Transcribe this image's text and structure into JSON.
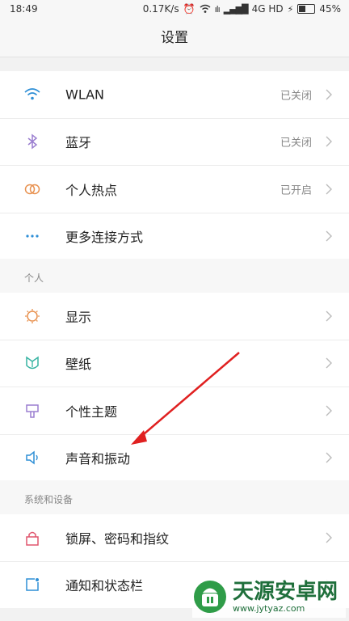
{
  "status_bar": {
    "time": "18:49",
    "net_speed": "0.17K/s",
    "network": "4G HD",
    "battery": "45%",
    "battery_level": 0.45
  },
  "header": {
    "title": "设置"
  },
  "connectivity": {
    "items": [
      {
        "label": "WLAN",
        "value": "已关闭",
        "icon": "wifi-icon",
        "color": "#2e8fd6"
      },
      {
        "label": "蓝牙",
        "value": "已关闭",
        "icon": "bluetooth-icon",
        "color": "#9b7fd0"
      },
      {
        "label": "个人热点",
        "value": "已开启",
        "icon": "hotspot-icon",
        "color": "#e8914f"
      },
      {
        "label": "更多连接方式",
        "value": "",
        "icon": "more-icon",
        "color": "#2e8fd6"
      }
    ]
  },
  "personal": {
    "header": "个人",
    "items": [
      {
        "label": "显示",
        "icon": "display-icon",
        "color": "#e8914f"
      },
      {
        "label": "壁纸",
        "icon": "wallpaper-icon",
        "color": "#36b3a2"
      },
      {
        "label": "个性主题",
        "icon": "theme-icon",
        "color": "#9b7fd0"
      },
      {
        "label": "声音和振动",
        "icon": "sound-icon",
        "color": "#2e8fd6"
      }
    ]
  },
  "system": {
    "header": "系统和设备",
    "items": [
      {
        "label": "锁屏、密码和指纹",
        "icon": "lock-icon",
        "color": "#e0566e"
      },
      {
        "label": "通知和状态栏",
        "icon": "notification-icon",
        "color": "#2e8fd6"
      }
    ]
  },
  "annotation_color": "#e02020",
  "watermark": {
    "name": "天源安卓网",
    "url": "www.jytyaz.com"
  }
}
